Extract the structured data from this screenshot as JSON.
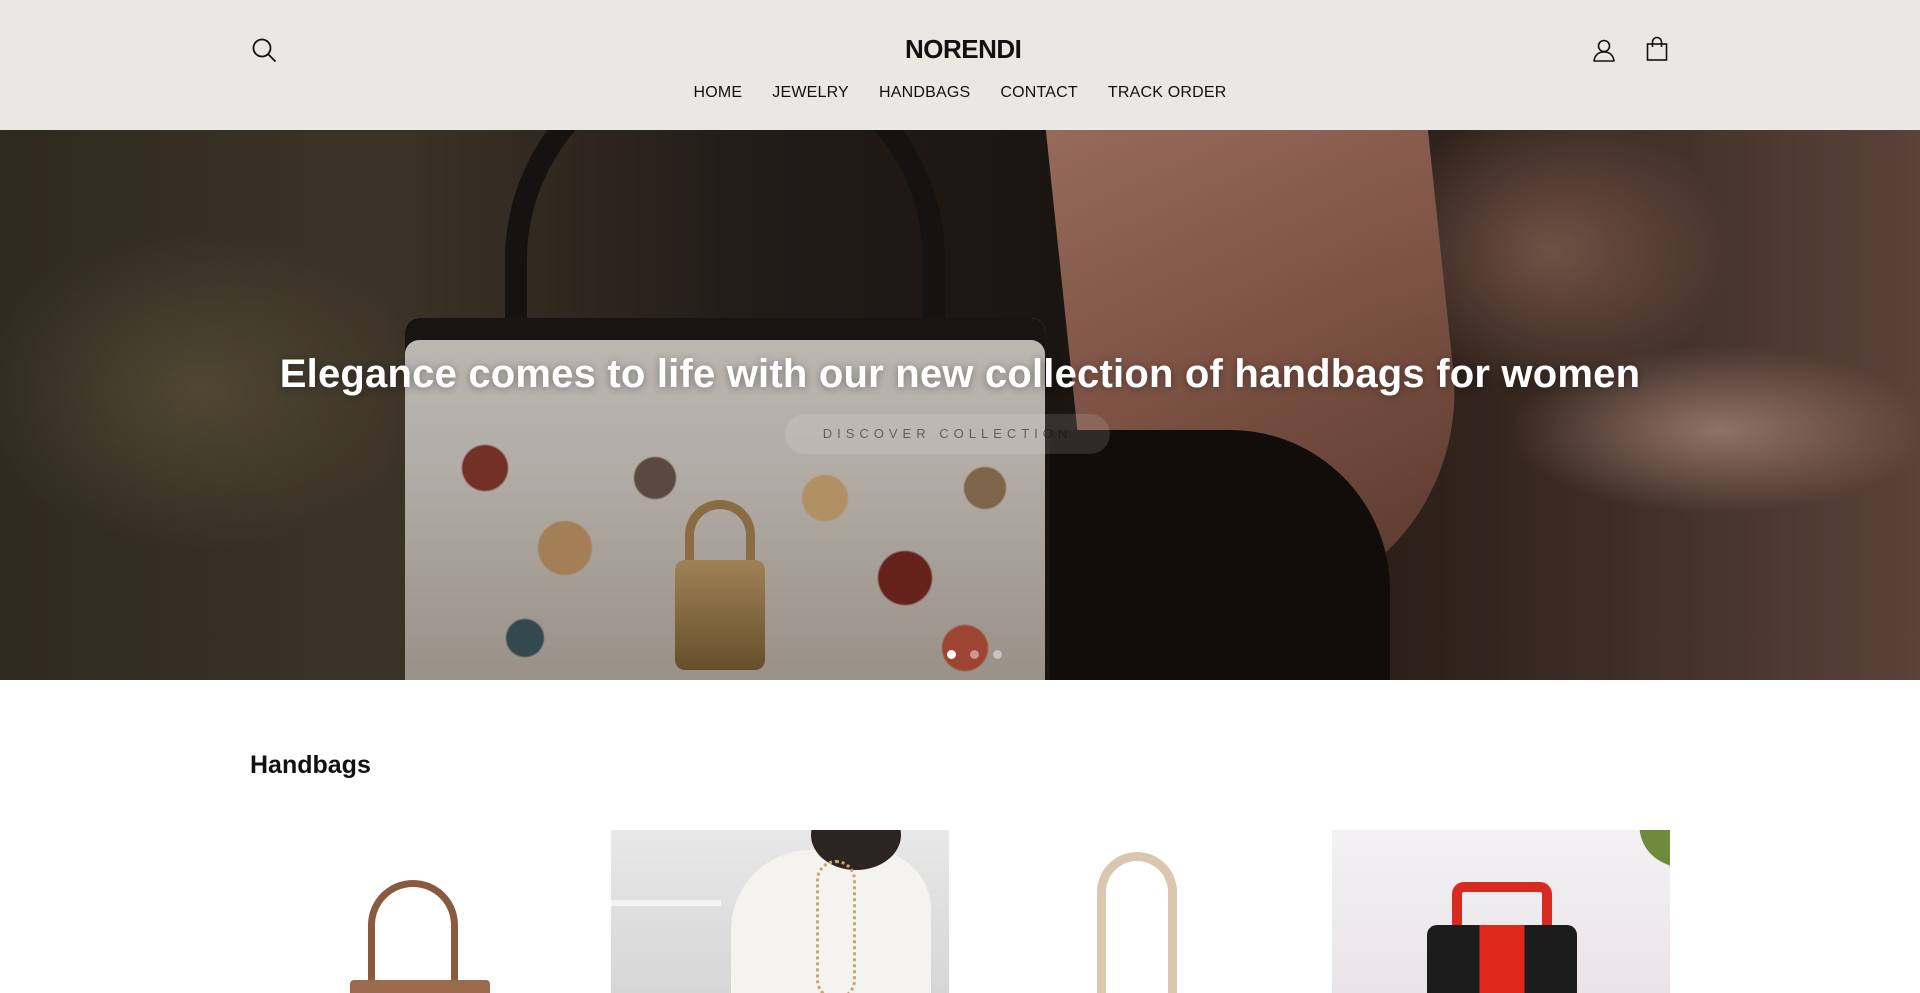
{
  "header": {
    "logo_text": "NORENDI",
    "icons": {
      "search": "search-icon",
      "account": "user-icon",
      "cart": "shopping-bag-icon"
    }
  },
  "nav": {
    "items": [
      {
        "label": "HOME"
      },
      {
        "label": "JEWELRY"
      },
      {
        "label": "HANDBAGS"
      },
      {
        "label": "CONTACT"
      },
      {
        "label": "TRACK ORDER"
      }
    ]
  },
  "hero": {
    "title": "Elegance comes to life with our new collection of handbags for women",
    "cta_label": "DISCOVER COLLECTION",
    "slide_count": 3,
    "active_slide": 1
  },
  "section": {
    "title": "Handbags"
  },
  "colors": {
    "header_bg": "#e9e8e3",
    "text": "#111111",
    "hero_text": "#ffffff"
  }
}
